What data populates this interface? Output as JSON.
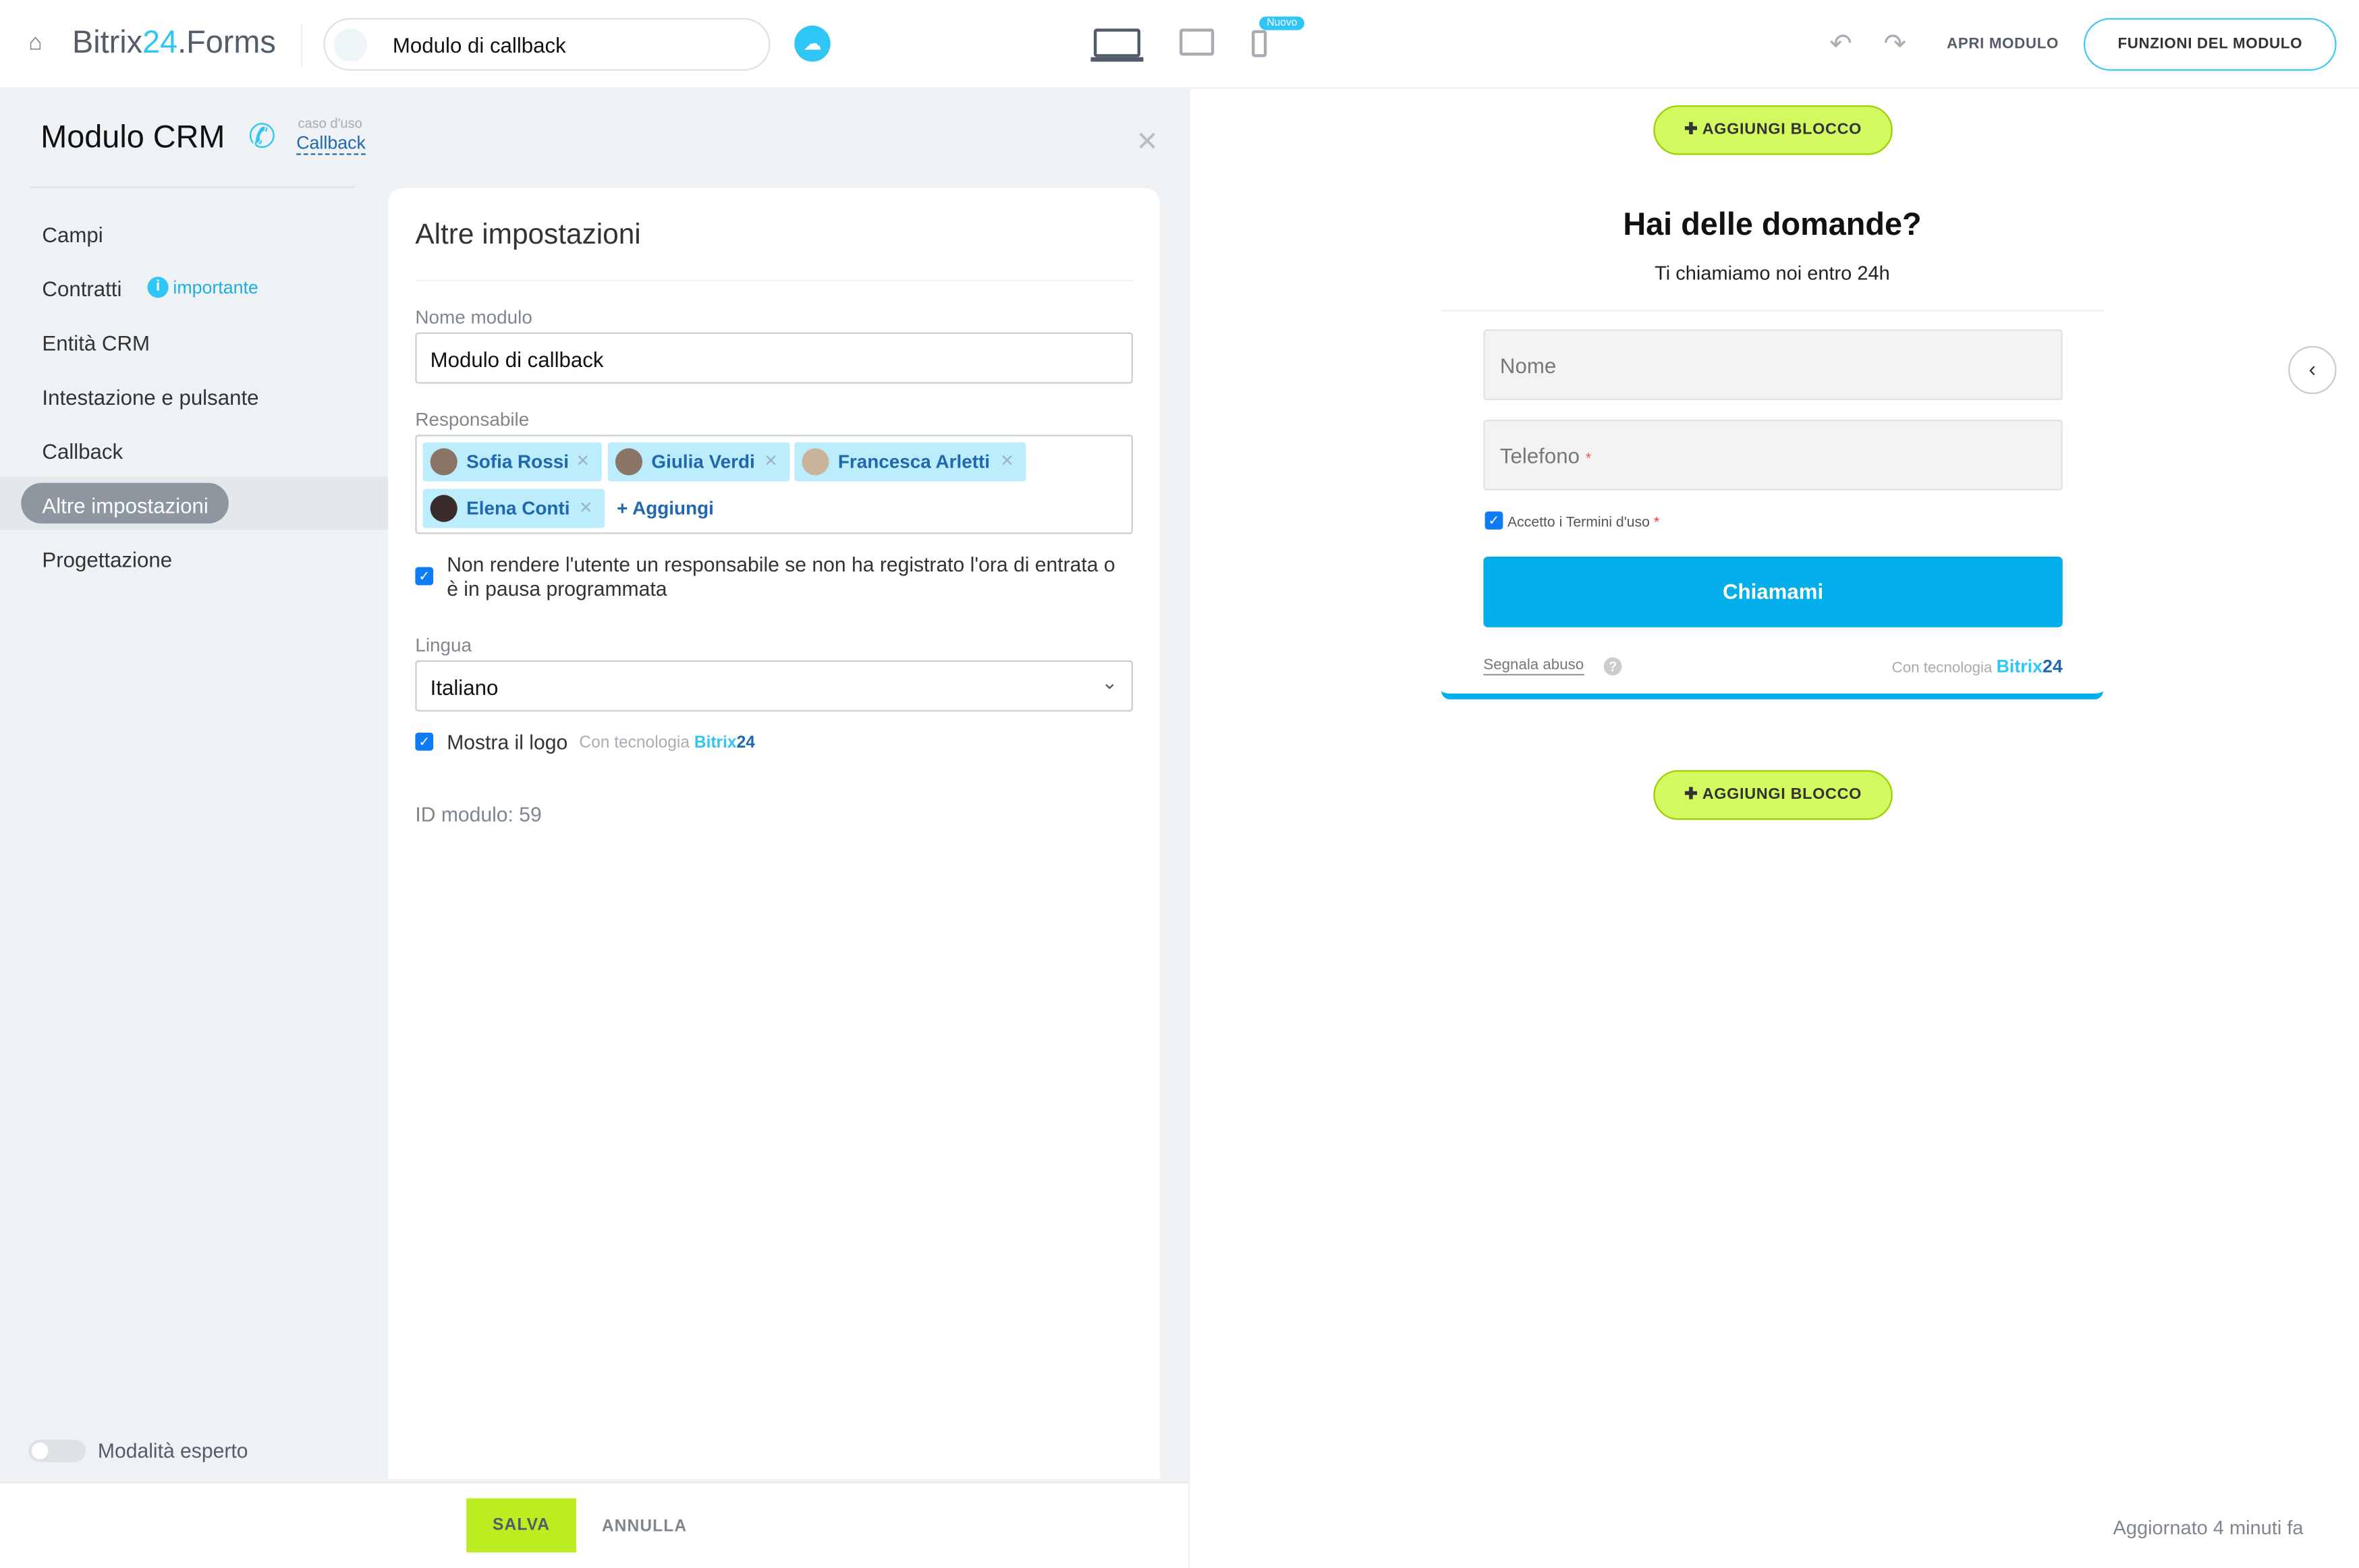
{
  "topbar": {
    "logo_main": "Bitrix",
    "logo_num": "24",
    "logo_suffix": ".Forms",
    "form_name": "Modulo di callback",
    "new_badge": "Nuovo",
    "open_label": "APRI MODULO",
    "functions_label": "FUNZIONI DEL MODULO"
  },
  "sidebar": {
    "title": "Modulo CRM",
    "use_case_label": "caso d'uso",
    "use_case": "Callback",
    "items": [
      {
        "label": "Campi"
      },
      {
        "label": "Contratti",
        "badge": "importante"
      },
      {
        "label": "Entità CRM"
      },
      {
        "label": "Intestazione e pulsante"
      },
      {
        "label": "Callback"
      },
      {
        "label": "Altre impostazioni",
        "selected": true
      },
      {
        "label": "Progettazione"
      }
    ],
    "expert_mode": "Modalità esperto",
    "expert_mode_on": false
  },
  "panel": {
    "title": "Altre impostazioni",
    "name_label": "Nome modulo",
    "name_value": "Modulo di callback",
    "resp_label": "Responsabile",
    "responsibles": [
      "Sofia Rossi",
      "Giulia Verdi",
      "Francesca Arletti",
      "Elena Conti"
    ],
    "add_label": "+ Aggiungi",
    "no_resp_check": "Non rendere l'utente un responsabile se non ha registrato l'ora di entrata o è in pausa programmata",
    "lang_label": "Lingua",
    "lang_value": "Italiano",
    "logo_check": "Mostra il logo",
    "powered": "Con tecnologia",
    "powered_brand": "Bitrix",
    "powered_num": "24",
    "form_id": "ID modulo: 59"
  },
  "footer": {
    "save": "SALVA",
    "cancel": "ANNULLA"
  },
  "preview": {
    "add_block": "AGGIUNGI BLOCCO",
    "heading": "Hai delle domande?",
    "subheading": "Ti chiamiamo noi entro 24h",
    "field_name": "Nome",
    "field_phone": "Telefono",
    "required_mark": "*",
    "terms": "Accetto i Termini d'uso",
    "button": "Chiamami",
    "report": "Segnala abuso",
    "powered": "Con tecnologia",
    "brand": "Bitrix",
    "brand_num": "24",
    "updated": "Aggiornato 4 minuti fa"
  },
  "colors": {
    "accent": "#2fc6f6",
    "button": "#03aeeb",
    "add_block": "#d2f95f",
    "save": "#bbed21"
  }
}
